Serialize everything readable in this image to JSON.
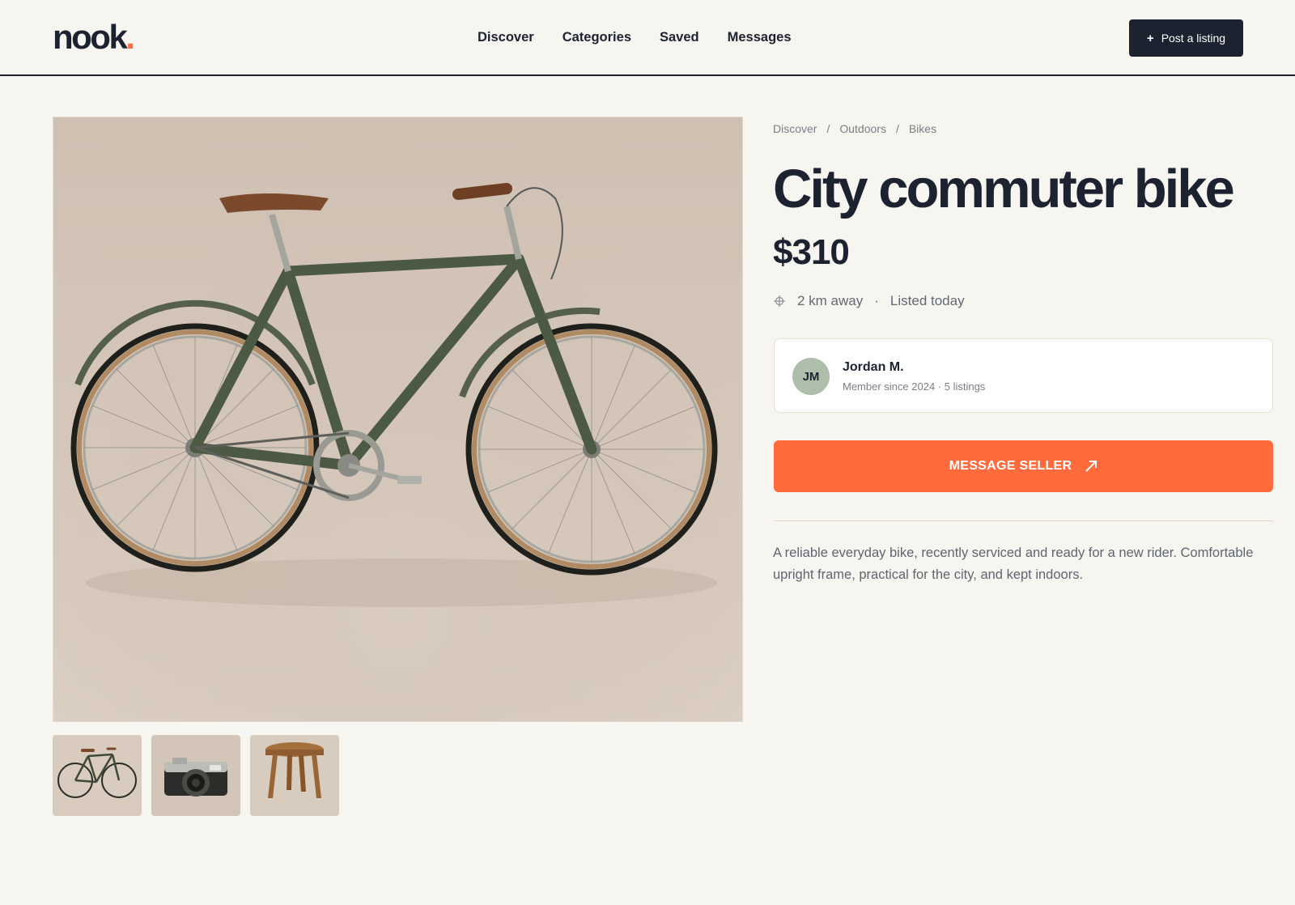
{
  "brand": {
    "name": "nook",
    "dot": ".",
    "accent": "#ff6b3d"
  },
  "nav": {
    "items": [
      {
        "label": "Discover"
      },
      {
        "label": "Categories"
      },
      {
        "label": "Saved"
      },
      {
        "label": "Messages"
      }
    ],
    "post_button": {
      "icon": "plus-icon",
      "plus": "+",
      "label": "Post a listing"
    }
  },
  "gallery": {
    "main_image": "bicycle-photo",
    "thumbnails": [
      "bicycle-thumbnail",
      "camera-thumbnail",
      "stool-thumbnail"
    ]
  },
  "listing": {
    "breadcrumb": {
      "items": [
        "Discover",
        "Outdoors",
        "Bikes"
      ],
      "separator": "/"
    },
    "title": "City commuter bike",
    "price": "$310",
    "distance": "2 km away",
    "meta_separator": "·",
    "listed": "Listed today",
    "description": "A reliable everyday bike, recently serviced and ready for a new rider. Comfortable upright frame, practical for the city, and kept indoors."
  },
  "seller": {
    "initials": "JM",
    "name": "Jordan M.",
    "subtitle": "Member since 2024 · 5 listings"
  },
  "cta": {
    "label": "MESSAGE SELLER",
    "icon": "arrow-up-right-icon"
  },
  "colors": {
    "ink": "#1c2230",
    "background": "#f7f5f0",
    "cta": "#ff6b3d",
    "avatar": "#adbfaa"
  }
}
